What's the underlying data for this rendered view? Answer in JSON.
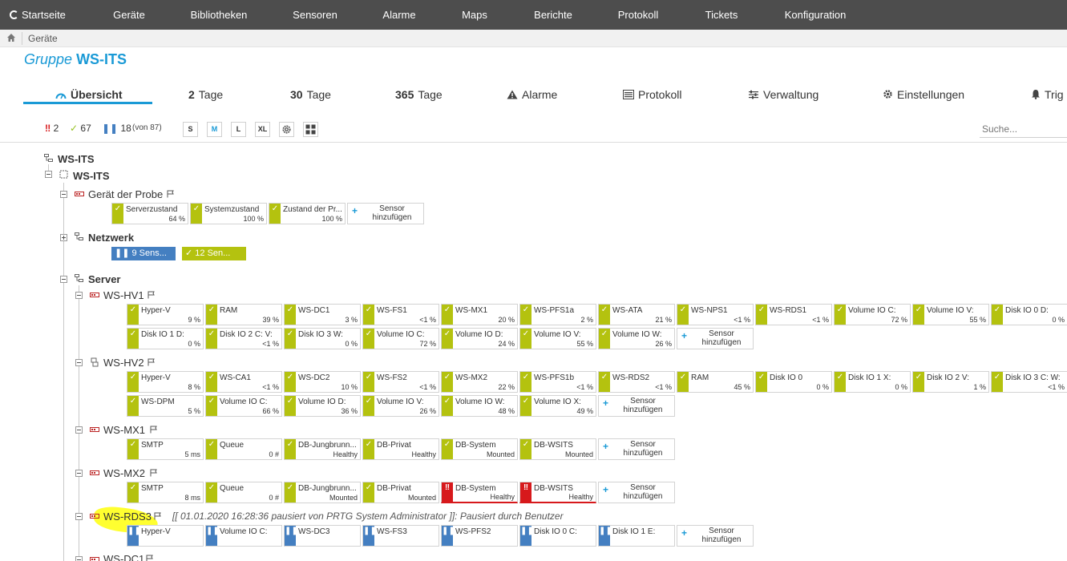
{
  "nav": {
    "home": "Startseite",
    "items": [
      "Geräte",
      "Bibliotheken",
      "Sensoren",
      "Alarme",
      "Maps",
      "Berichte",
      "Protokoll",
      "Tickets",
      "Konfiguration"
    ]
  },
  "breadcrumb": {
    "current": "Geräte"
  },
  "title": {
    "prefix": "Gruppe",
    "name": "WS-ITS"
  },
  "tabs": {
    "overview": "Übersicht",
    "days2_num": "2",
    "days2_label": "Tage",
    "days30_num": "30",
    "days30_label": "Tage",
    "days365_num": "365",
    "days365_label": "Tage",
    "alarms": "Alarme",
    "log": "Protokoll",
    "manage": "Verwaltung",
    "settings": "Einstellungen",
    "triggers": "Trig"
  },
  "toolbar": {
    "down_count": "2",
    "up_count": "67",
    "paused_count": "18",
    "total": "(von 87)",
    "sizes": [
      "S",
      "M",
      "L",
      "XL"
    ],
    "search_placeholder": "Suche..."
  },
  "tree": {
    "root": "WS-ITS",
    "probe": "WS-ITS",
    "probe_device": "Gerät der Probe",
    "network": "Netzwerk",
    "network_paused": "9 Sens...",
    "network_up": "12 Sen...",
    "server": "Server",
    "hv1": "WS-HV1",
    "hv2": "WS-HV2",
    "mx1": "WS-MX1",
    "mx2": "WS-MX2",
    "rds3": "WS-RDS3",
    "dc1": "WS-DC1",
    "rds3_note": "[[ 01.01.2020 16:28:36 pausiert von PRTG System Administrator ]]: Pausiert durch Benutzer",
    "add_sensor_line1": "Sensor",
    "add_sensor_line2": "hinzufügen"
  },
  "sensors": {
    "probe": [
      {
        "name": "Serverzustand",
        "value": "64 %",
        "status": "ok"
      },
      {
        "name": "Systemzustand",
        "value": "100 %",
        "status": "ok"
      },
      {
        "name": "Zustand der Pr...",
        "value": "100 %",
        "status": "ok"
      }
    ],
    "hv1": [
      {
        "name": "Hyper-V",
        "value": "9 %",
        "status": "ok"
      },
      {
        "name": "RAM",
        "value": "39 %",
        "status": "ok"
      },
      {
        "name": "WS-DC1",
        "value": "3 %",
        "status": "ok"
      },
      {
        "name": "WS-FS1",
        "value": "<1 %",
        "status": "ok"
      },
      {
        "name": "WS-MX1",
        "value": "20 %",
        "status": "ok"
      },
      {
        "name": "WS-PFS1a",
        "value": "2 %",
        "status": "ok"
      },
      {
        "name": "WS-ATA",
        "value": "21 %",
        "status": "ok"
      },
      {
        "name": "WS-NPS1",
        "value": "<1 %",
        "status": "ok"
      },
      {
        "name": "WS-RDS1",
        "value": "<1 %",
        "status": "ok"
      },
      {
        "name": "Volume IO C:",
        "value": "72 %",
        "status": "ok"
      },
      {
        "name": "Volume IO V:",
        "value": "55 %",
        "status": "ok"
      },
      {
        "name": "Disk IO 0 D:",
        "value": "0 %",
        "status": "ok"
      },
      {
        "name": "Disk IO 1 D:",
        "value": "0 %",
        "status": "ok"
      },
      {
        "name": "Disk IO 2 C: V:",
        "value": "<1 %",
        "status": "ok"
      },
      {
        "name": "Disk IO 3 W:",
        "value": "0 %",
        "status": "ok"
      },
      {
        "name": "Volume IO C:",
        "value": "72 %",
        "status": "ok"
      },
      {
        "name": "Volume IO D:",
        "value": "24 %",
        "status": "ok"
      },
      {
        "name": "Volume IO V:",
        "value": "55 %",
        "status": "ok"
      },
      {
        "name": "Volume IO W:",
        "value": "26 %",
        "status": "ok"
      }
    ],
    "hv2": [
      {
        "name": "Hyper-V",
        "value": "8 %",
        "status": "ok"
      },
      {
        "name": "WS-CA1",
        "value": "<1 %",
        "status": "ok"
      },
      {
        "name": "WS-DC2",
        "value": "10 %",
        "status": "ok"
      },
      {
        "name": "WS-FS2",
        "value": "<1 %",
        "status": "ok"
      },
      {
        "name": "WS-MX2",
        "value": "22 %",
        "status": "ok"
      },
      {
        "name": "WS-PFS1b",
        "value": "<1 %",
        "status": "ok"
      },
      {
        "name": "WS-RDS2",
        "value": "<1 %",
        "status": "ok"
      },
      {
        "name": "RAM",
        "value": "45 %",
        "status": "ok"
      },
      {
        "name": "Disk IO 0",
        "value": "0 %",
        "status": "ok"
      },
      {
        "name": "Disk IO 1 X:",
        "value": "0 %",
        "status": "ok"
      },
      {
        "name": "Disk IO 2 V:",
        "value": "1 %",
        "status": "ok"
      },
      {
        "name": "Disk IO 3 C: W:",
        "value": "<1 %",
        "status": "ok"
      },
      {
        "name": "WS-DPM",
        "value": "5 %",
        "status": "ok"
      },
      {
        "name": "Volume IO C:",
        "value": "66 %",
        "status": "ok"
      },
      {
        "name": "Volume IO D:",
        "value": "36 %",
        "status": "ok"
      },
      {
        "name": "Volume IO V:",
        "value": "26 %",
        "status": "ok"
      },
      {
        "name": "Volume IO W:",
        "value": "48 %",
        "status": "ok"
      },
      {
        "name": "Volume IO X:",
        "value": "49 %",
        "status": "ok"
      }
    ],
    "mx1": [
      {
        "name": "SMTP",
        "value": "5 ms",
        "status": "ok"
      },
      {
        "name": "Queue",
        "value": "0 #",
        "status": "ok"
      },
      {
        "name": "DB-Jungbrunn...",
        "value": "Healthy",
        "status": "ok"
      },
      {
        "name": "DB-Privat",
        "value": "Healthy",
        "status": "ok"
      },
      {
        "name": "DB-System",
        "value": "Mounted",
        "status": "ok"
      },
      {
        "name": "DB-WSITS",
        "value": "Mounted",
        "status": "ok"
      }
    ],
    "mx2": [
      {
        "name": "SMTP",
        "value": "8 ms",
        "status": "ok"
      },
      {
        "name": "Queue",
        "value": "0 #",
        "status": "ok"
      },
      {
        "name": "DB-Jungbrunn...",
        "value": "Mounted",
        "status": "ok"
      },
      {
        "name": "DB-Privat",
        "value": "Mounted",
        "status": "ok"
      },
      {
        "name": "DB-System",
        "value": "Healthy",
        "status": "down"
      },
      {
        "name": "DB-WSITS",
        "value": "Healthy",
        "status": "down"
      }
    ],
    "rds3": [
      {
        "name": "Hyper-V",
        "value": "",
        "status": "paused"
      },
      {
        "name": "Volume IO C:",
        "value": "",
        "status": "paused"
      },
      {
        "name": "WS-DC3",
        "value": "",
        "status": "paused"
      },
      {
        "name": "WS-FS3",
        "value": "",
        "status": "paused"
      },
      {
        "name": "WS-PFS2",
        "value": "",
        "status": "paused"
      },
      {
        "name": "Disk IO 0 C:",
        "value": "",
        "status": "paused"
      },
      {
        "name": "Disk IO 1 E:",
        "value": "",
        "status": "paused"
      }
    ]
  }
}
